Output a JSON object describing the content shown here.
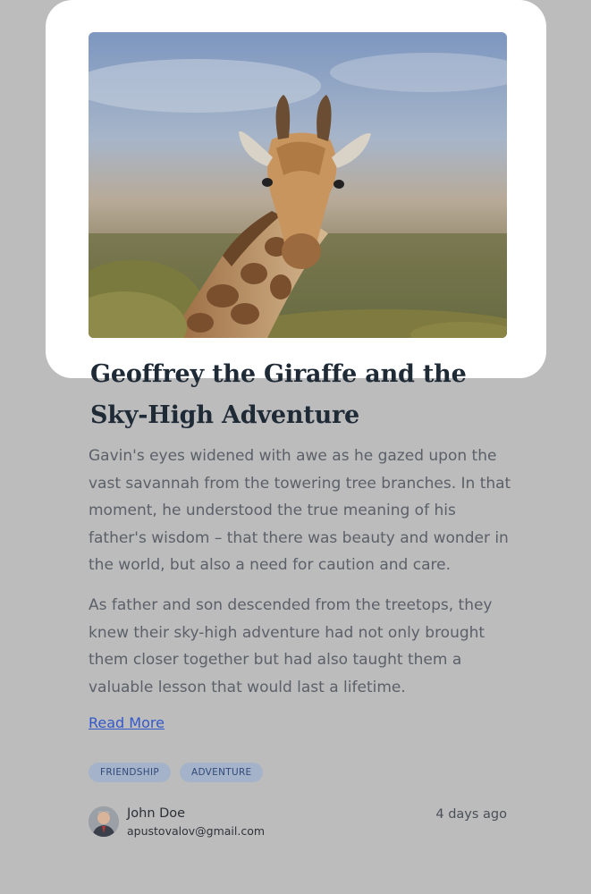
{
  "card": {
    "image": {
      "alt": "giraffe-photo"
    },
    "title": "Geoffrey the Giraffe and the Sky-High Adventure",
    "paragraphs": [
      "Gavin's eyes widened with awe as he gazed upon the vast savannah from the towering tree branches. In that moment, he understood the true meaning of his father's wisdom – that there was beauty and wonder in the world, but also a need for caution and care.",
      "As father and son descended from the treetops, they knew their sky-high adventure had not only brought them closer together but had also taught them a valuable lesson that would last a lifetime."
    ],
    "read_more": "Read More",
    "tags": [
      "FRIENDSHIP",
      "ADVENTURE"
    ],
    "author": {
      "name": "John Doe",
      "email": "apustovalov@gmail.com",
      "avatar_icon": "user-avatar"
    },
    "time_ago": "4 days ago"
  },
  "colors": {
    "background": "#bcbcbc",
    "card": "#ffffff",
    "link": "#3358c9",
    "tag_bg": "#a4b3ca",
    "tag_text": "#324a79"
  }
}
